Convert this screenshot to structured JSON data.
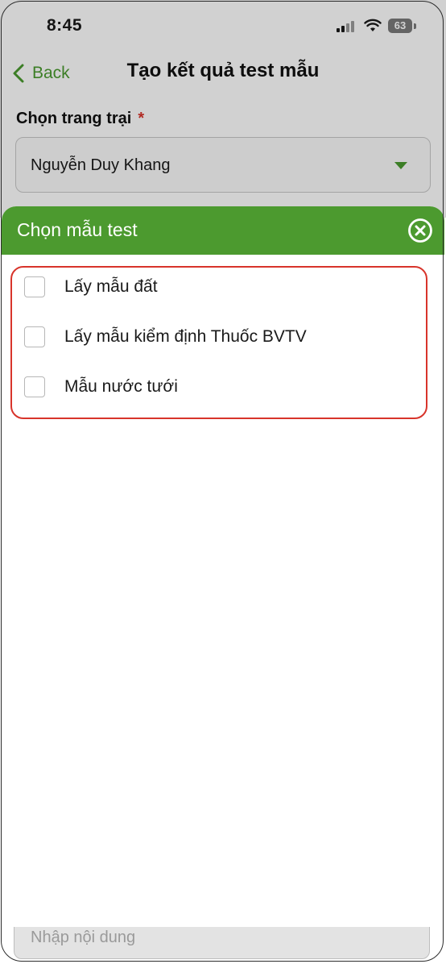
{
  "status_bar": {
    "time": "8:45",
    "battery": "63",
    "icons": [
      "signal-icon",
      "wifi-icon",
      "battery-icon"
    ]
  },
  "header": {
    "back_label": "Back",
    "title": "Tạo kết quả test mẫu"
  },
  "farm": {
    "label": "Chọn trang trại",
    "required_mark": "*",
    "selected": "Nguyễn Duy Khang"
  },
  "sheet": {
    "title": "Chọn mẫu test",
    "options": [
      {
        "label": "Lấy mẫu đất",
        "checked": false
      },
      {
        "label": "Lấy mẫu kiểm định Thuốc BVTV",
        "checked": false
      },
      {
        "label": "Mẫu nước tưới",
        "checked": false
      }
    ]
  },
  "content_input": {
    "placeholder": "Nhập nội dung"
  },
  "colors": {
    "accent": "#4c9a2f",
    "highlight": "#d8342b"
  }
}
